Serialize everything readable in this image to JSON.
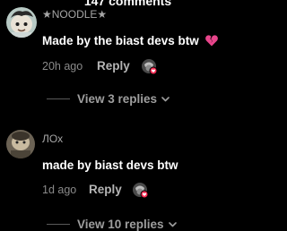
{
  "header": {
    "title": "147 comments"
  },
  "comments": [
    {
      "username": "★NOODLE★",
      "text": "Made by the biast devs btw",
      "time": "20h ago",
      "reply_label": "Reply",
      "view_replies_label": "View 3 replies"
    },
    {
      "username": "ЛОх",
      "text": "made by biast devs btw",
      "time": "1d ago",
      "reply_label": "Reply",
      "view_replies_label": "View 10 replies"
    }
  ],
  "icons": {
    "heart": "broken-heart-icon",
    "chevron": "chevron-down-icon",
    "creator_badge": "creator-liked-avatar-icon"
  },
  "colors": {
    "background": "#000000",
    "heart": "#e8458b",
    "badge": "#fe2c55"
  }
}
